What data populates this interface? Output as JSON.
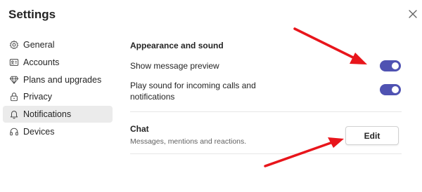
{
  "window": {
    "title": "Settings",
    "close_icon": "close-icon"
  },
  "sidebar": {
    "items": [
      {
        "label": "General",
        "icon": "gear-icon",
        "active": false
      },
      {
        "label": "Accounts",
        "icon": "id-card-icon",
        "active": false
      },
      {
        "label": "Plans and upgrades",
        "icon": "diamond-icon",
        "active": false
      },
      {
        "label": "Privacy",
        "icon": "lock-icon",
        "active": false
      },
      {
        "label": "Notifications",
        "icon": "bell-icon",
        "active": true
      },
      {
        "label": "Devices",
        "icon": "headset-icon",
        "active": false
      }
    ]
  },
  "appearance": {
    "heading": "Appearance and sound",
    "show_preview_label": "Show message preview",
    "show_preview_on": true,
    "play_sound_label_line1": "Play sound for incoming calls and",
    "play_sound_label_line2": "notifications",
    "play_sound_on": true
  },
  "chat": {
    "heading": "Chat",
    "description": "Messages, mentions and reactions.",
    "edit_label": "Edit"
  },
  "colors": {
    "toggle_on": "#4f52b2",
    "annotation_arrow": "#e8151b",
    "active_nav_bg": "#ebebeb"
  }
}
